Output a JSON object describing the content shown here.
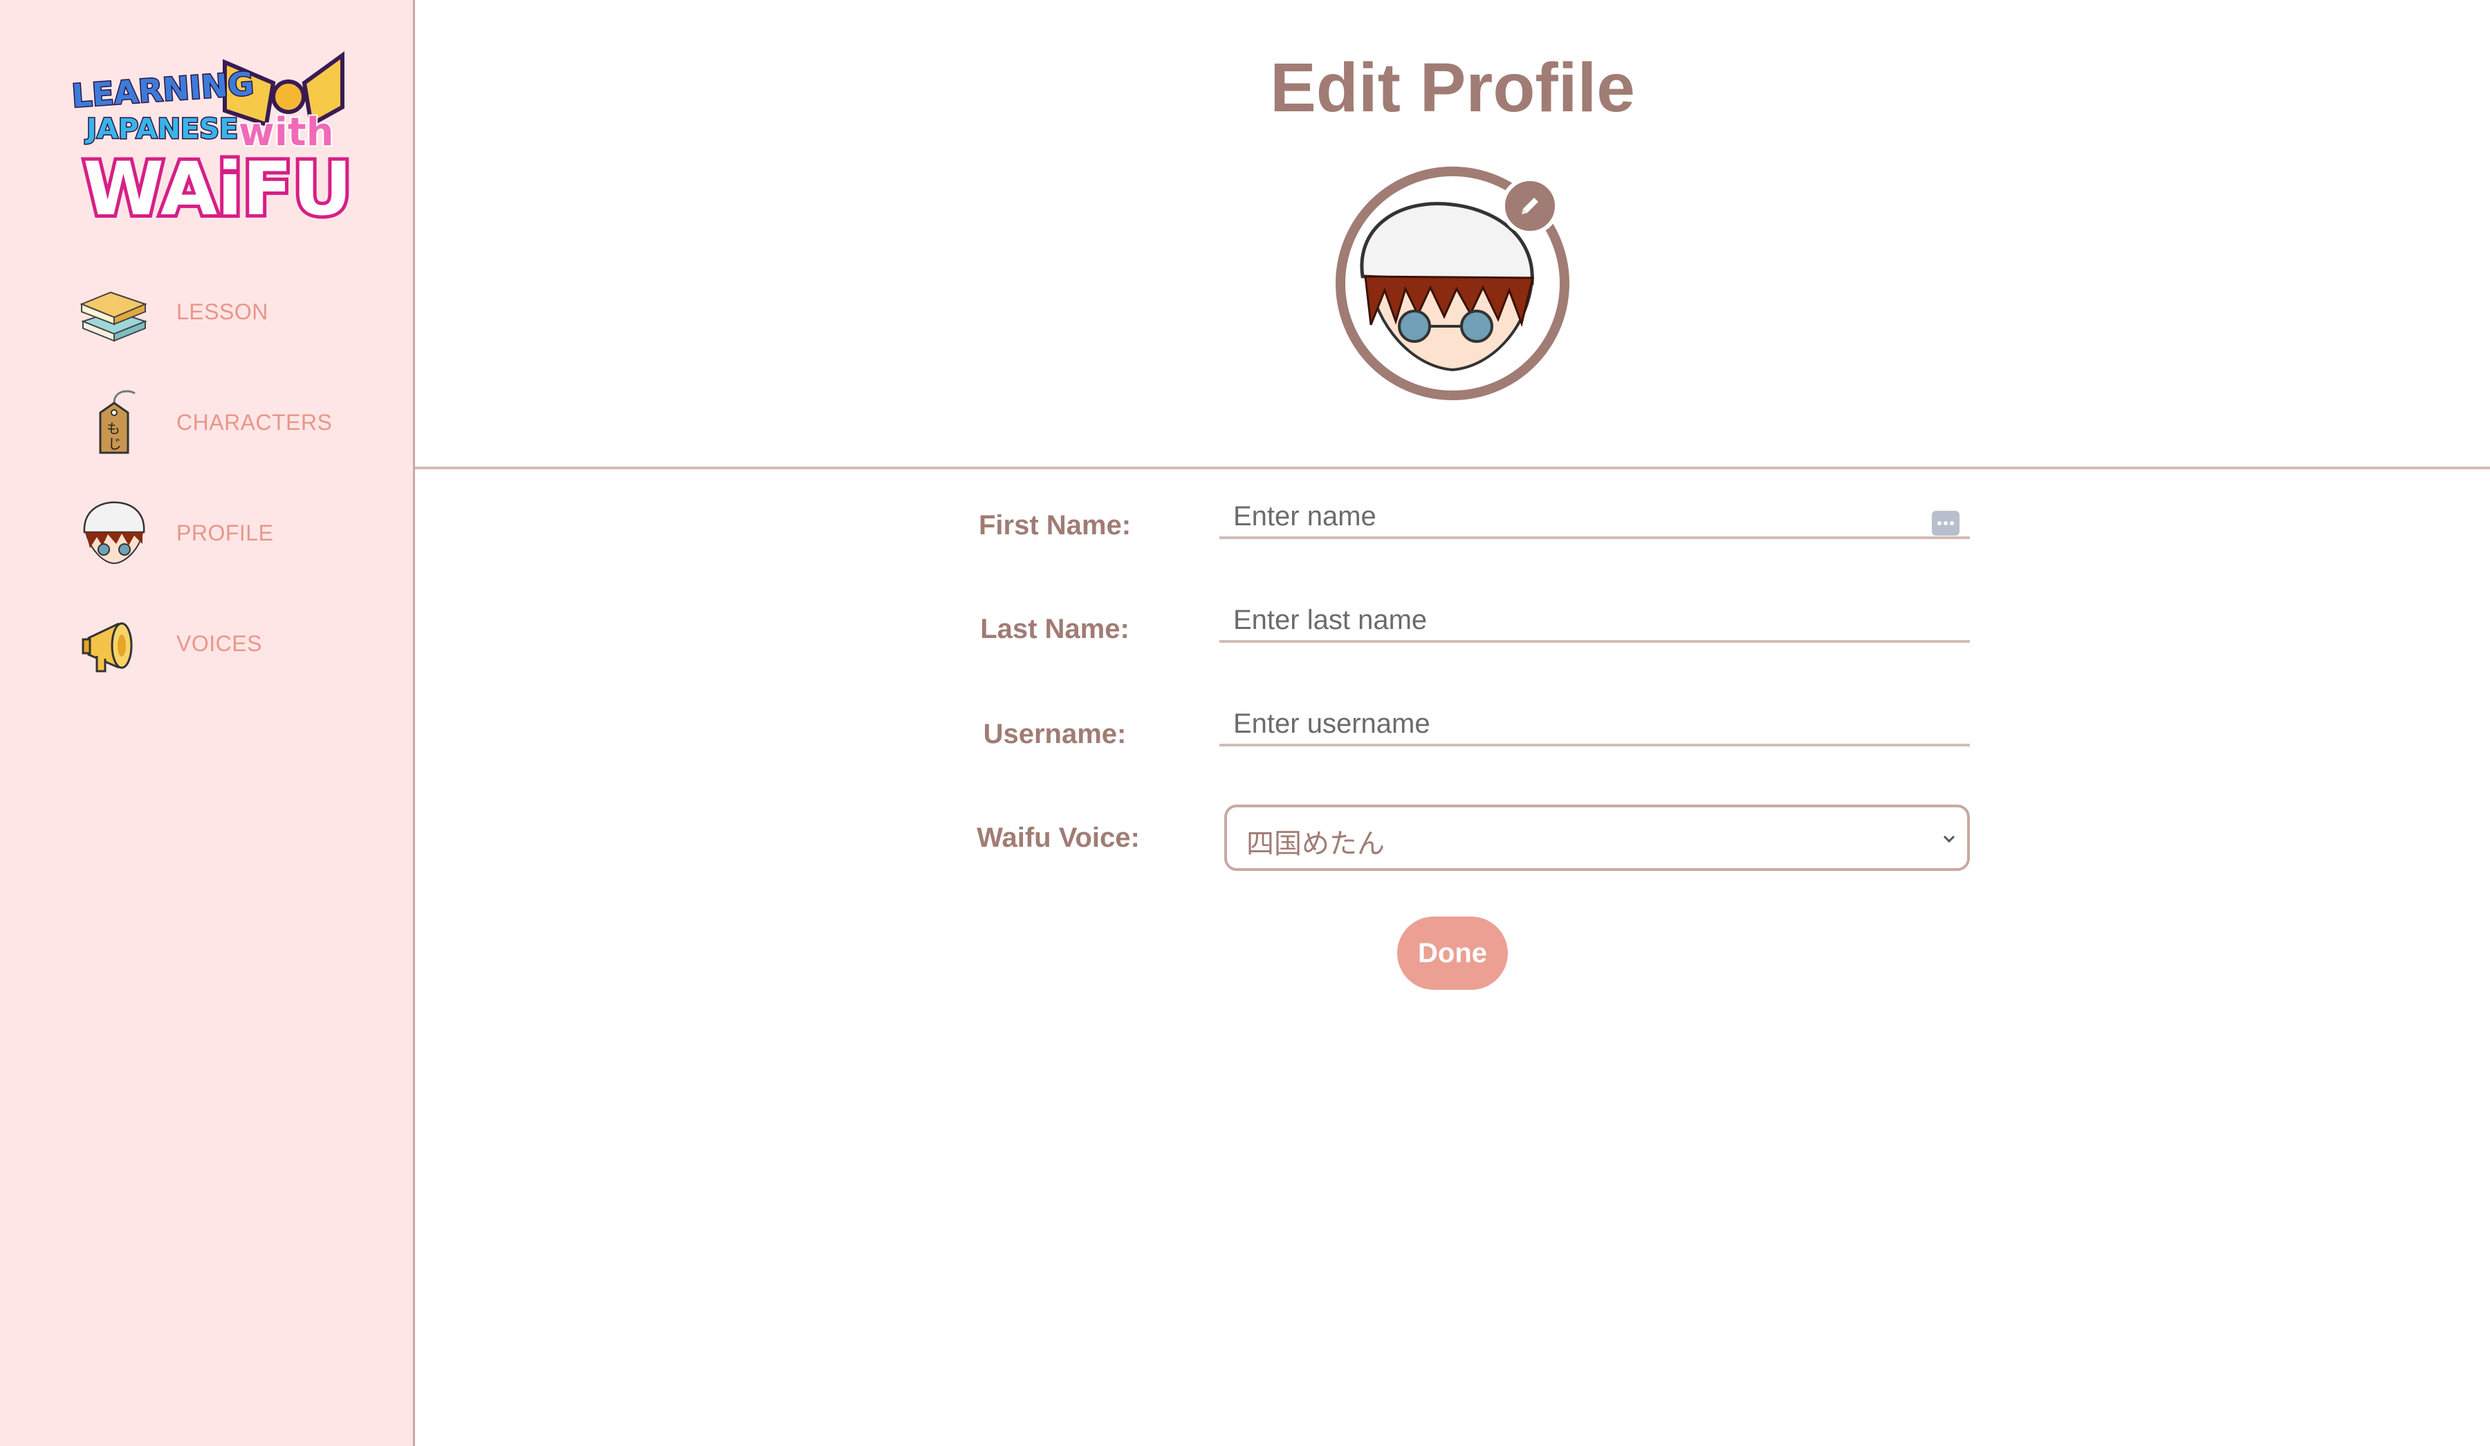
{
  "sidebar": {
    "logo": {
      "line1": "LEARNING",
      "line2": "JAPANESE",
      "line3": "with",
      "line4": "WAiFU"
    },
    "items": [
      {
        "label": "LESSON",
        "icon": "books-icon"
      },
      {
        "label": "CHARACTERS",
        "icon": "moji-tag-icon"
      },
      {
        "label": "PROFILE",
        "icon": "profile-avatar-icon"
      },
      {
        "label": "VOICES",
        "icon": "megaphone-icon"
      }
    ]
  },
  "main": {
    "title": "Edit Profile",
    "avatar_edit_icon": "pencil-icon",
    "form": {
      "first_name": {
        "label": "First Name:",
        "placeholder": "Enter name",
        "value": ""
      },
      "last_name": {
        "label": "Last Name:",
        "placeholder": "Enter last name",
        "value": ""
      },
      "username": {
        "label": "Username:",
        "placeholder": "Enter username",
        "value": ""
      },
      "waifu_voice": {
        "label": "Waifu Voice:",
        "selected": "四国めたん"
      },
      "done_label": "Done"
    }
  },
  "colors": {
    "sidebar_bg": "#ffe6e6",
    "accent": "#a07c74",
    "nav_text": "#e8968a",
    "button_bg": "#eba093"
  }
}
